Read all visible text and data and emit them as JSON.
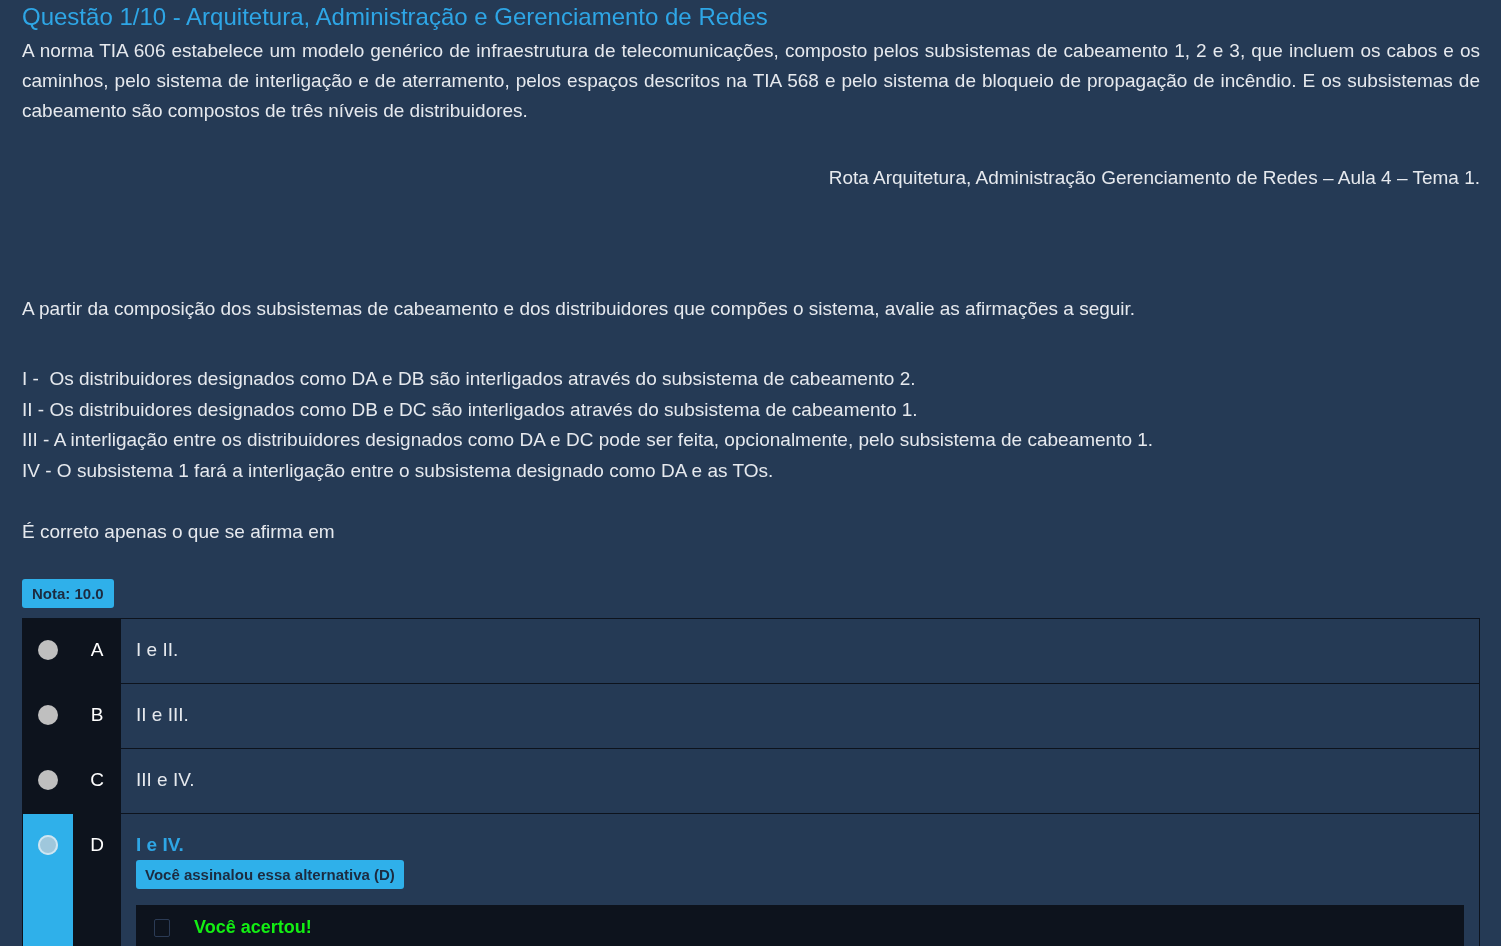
{
  "question": {
    "title": "Questão 1/10 - Arquitetura, Administração e Gerenciamento de Redes",
    "intro": "A norma TIA 606 estabelece um modelo genérico de infraestrutura de telecomunicações, composto pelos subsistemas de cabeamento 1, 2 e 3, que incluem os cabos e os caminhos, pelo sistema de interligação e de aterramento, pelos espaços descritos na TIA 568 e pelo sistema de bloqueio de propagação de incêndio. E os subsistemas de cabeamento são compostos de três níveis de distribuidores.",
    "source": "Rota Arquitetura, Administração Gerenciamento de Redes – Aula 4 – Tema 1.",
    "prompt": "A partir da composição dos subsistemas de cabeamento e dos distribuidores que compões o sistema, avalie as afirmações a seguir.",
    "statements": [
      "I -  Os distribuidores designados como DA e DB são interligados através do subsistema de cabeamento 2.",
      "II - Os distribuidores designados como DB e DC são interligados através do subsistema de cabeamento 1.",
      "III - A interligação entre os distribuidores designados como DA e DC pode ser feita, opcionalmente, pelo subsistema de cabeamento 1.",
      "IV - O subsistema 1 fará a interligação entre o subsistema designado como DA e as TOs."
    ],
    "closing": "É correto apenas o que se afirma em"
  },
  "grade": "Nota: 10.0",
  "options": [
    {
      "letter": "A",
      "text": "I e II.",
      "selected": false
    },
    {
      "letter": "B",
      "text": "II e III.",
      "selected": false
    },
    {
      "letter": "C",
      "text": "III e IV.",
      "selected": false
    },
    {
      "letter": "D",
      "text": "I e IV.",
      "selected": true,
      "marked_label": "Você assinalou essa alternativa (D)",
      "feedback": "Você acertou!"
    }
  ]
}
